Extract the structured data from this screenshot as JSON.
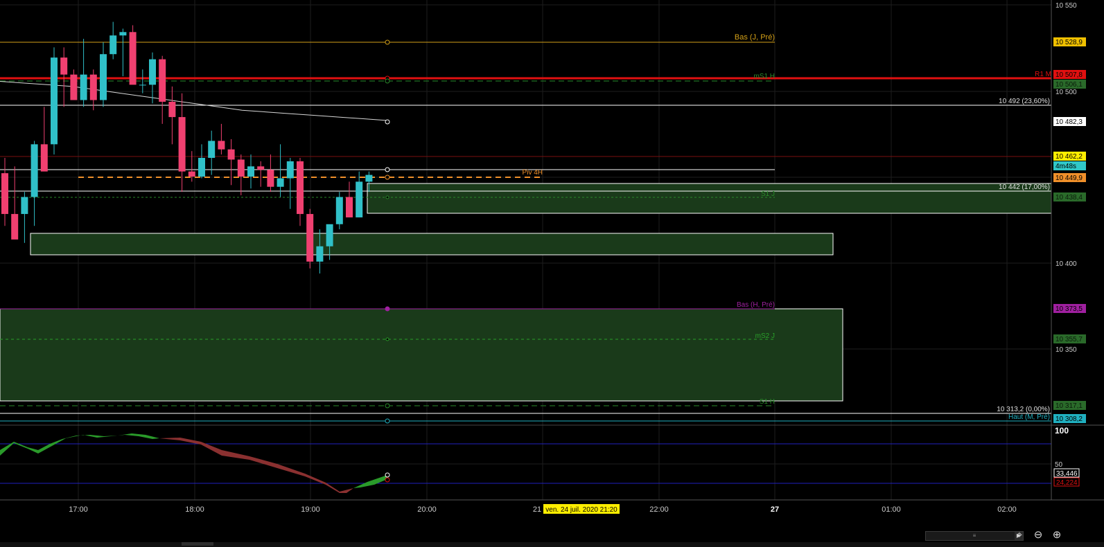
{
  "price_axis": {
    "ticks": [
      "10 550",
      "10 500",
      "10 450",
      "10 400",
      "10 350"
    ],
    "badges": [
      {
        "text": "10 528,9",
        "color": "#f0c000",
        "fg": "#000"
      },
      {
        "text": "10 507,8",
        "color": "#e01010",
        "fg": "#000"
      },
      {
        "text": "10 506,1",
        "color": "#2a6a2a",
        "fg": "#0a1a0a"
      },
      {
        "text": "10 482,3",
        "color": "#ffffff",
        "fg": "#000"
      },
      {
        "text": "10 462,2",
        "color": "#ffee00",
        "fg": "#000"
      },
      {
        "text": "4m48s",
        "color": "#30c8c8",
        "fg": "#000"
      },
      {
        "text": "10 449,9",
        "color": "#f0902a",
        "fg": "#000"
      },
      {
        "text": "10 438,4",
        "color": "#2a6a2a",
        "fg": "#0a1a0a"
      },
      {
        "text": "10 373,5",
        "color": "#a020a0",
        "fg": "#000"
      },
      {
        "text": "10 355,7",
        "color": "#2a6a2a",
        "fg": "#0a1a0a"
      },
      {
        "text": "10 317,1",
        "color": "#2a6a2a",
        "fg": "#0a1a0a"
      },
      {
        "text": "10 308,2",
        "color": "#20b0c0",
        "fg": "#000"
      }
    ]
  },
  "levels": {
    "bas_j_pre": "Bas (J, Pré)",
    "r1_m": "R1 M",
    "ms1_h": "mS1 H",
    "fib_23": "10 492 (23,60%)",
    "piv_4h": "Piv 4H",
    "fib_17": "10 442 (17,00%)",
    "s1_j": "S1 J",
    "bas_h_pre": "Bas (H, Pré)",
    "ms2_j": "mS2 J",
    "s1_h": "S1 H",
    "fib_0": "10 313,2 (0,00%)",
    "haut_m_pre": "Haut (M, Pré)"
  },
  "oscillator": {
    "axis_100": "100",
    "axis_50": "50",
    "value_1": "33,446",
    "value_2": "24,224"
  },
  "time_axis": {
    "labels": [
      "17:00",
      "18:00",
      "19:00",
      "20:00",
      "21",
      "22:00",
      "27",
      "01:00",
      "02:00"
    ],
    "cursor_label": "ven. 24 juil. 2020 21:20"
  },
  "chart_data": {
    "type": "candlestick",
    "x": [
      "16:35",
      "16:40",
      "16:45",
      "16:50",
      "16:55",
      "17:00",
      "17:05",
      "17:10",
      "17:15",
      "17:20",
      "17:25",
      "17:30",
      "17:35",
      "17:40",
      "17:45",
      "17:50",
      "17:55",
      "18:00",
      "18:05",
      "18:10",
      "18:15",
      "18:20",
      "18:25",
      "18:30",
      "18:35",
      "18:40",
      "18:45",
      "18:50",
      "18:55",
      "19:00",
      "19:05",
      "19:10",
      "19:15",
      "19:20",
      "19:25",
      "19:30",
      "19:35",
      "19:40"
    ],
    "open": [
      10451,
      10427,
      10427,
      10437,
      10468,
      10468,
      10519,
      10509,
      10494,
      10509,
      10494,
      10521,
      10532,
      10534,
      10503,
      10503,
      10518,
      10493,
      10484,
      10452,
      10449,
      10460,
      10470,
      10465,
      10459,
      10449,
      10455,
      10453,
      10443,
      10448,
      10458,
      10427,
      10399,
      10408,
      10421,
      10437,
      10425,
      10446
    ],
    "high": [
      10460,
      10455,
      10440,
      10470,
      10490,
      10525,
      10525,
      10512,
      10530,
      10512,
      10528,
      10540,
      10536,
      10538,
      10512,
      10522,
      10520,
      10502,
      10498,
      10464,
      10468,
      10476,
      10480,
      10471,
      10462,
      10462,
      10458,
      10462,
      10468,
      10460,
      10460,
      10430,
      10418,
      10420,
      10440,
      10446,
      10452,
      10452
    ],
    "low": [
      10420,
      10423,
      10410,
      10420,
      10460,
      10462,
      10490,
      10495,
      10490,
      10488,
      10490,
      10518,
      10508,
      10505,
      10498,
      10492,
      10480,
      10468,
      10440,
      10446,
      10448,
      10450,
      10462,
      10444,
      10438,
      10442,
      10443,
      10440,
      10437,
      10430,
      10420,
      10395,
      10392,
      10400,
      10418,
      10425,
      10425,
      10440
    ],
    "close": [
      10427,
      10412,
      10437,
      10468,
      10452,
      10519,
      10509,
      10494,
      10509,
      10494,
      10521,
      10532,
      10534,
      10503,
      10503,
      10518,
      10493,
      10484,
      10452,
      10449,
      10460,
      10470,
      10465,
      10459,
      10449,
      10455,
      10453,
      10443,
      10448,
      10458,
      10427,
      10399,
      10408,
      10421,
      10437,
      10425,
      10446,
      10450
    ],
    "ylim": [
      10290,
      10550
    ],
    "moving_average": [
      10505,
      10504,
      10503,
      10502,
      10500,
      10498,
      10496,
      10494,
      10492,
      10490,
      10488,
      10487,
      10486,
      10485,
      10484,
      10483,
      10482
    ]
  },
  "toolbar": {
    "scroll_thumb": "≡",
    "scroll_arrow": "▶",
    "zoom_fit_icon": "⌖",
    "zoom_out_icon": "⊖",
    "zoom_in_icon": "⊕"
  },
  "colors": {
    "bull": "#30c0c8",
    "bear": "#f04070",
    "zone_fill": "#1a3a1a",
    "grid": "#1e1e1e"
  }
}
